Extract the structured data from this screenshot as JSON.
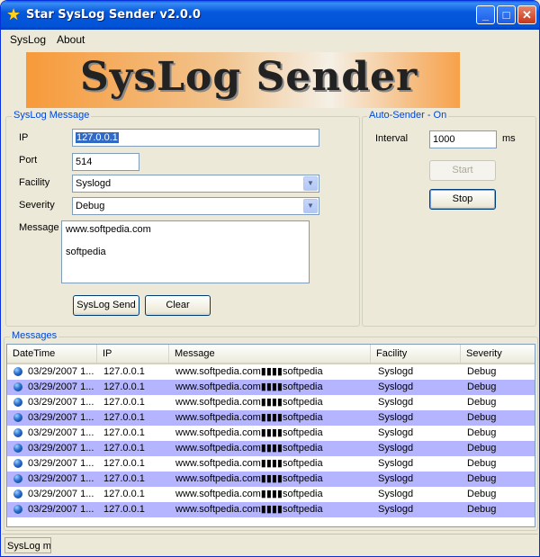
{
  "window": {
    "title": "Star SysLog Sender v2.0.0"
  },
  "menu": [
    "SysLog",
    "About"
  ],
  "banner": {
    "text": "SysLog Sender"
  },
  "syslog_message": {
    "group_label": "SysLog Message",
    "ip_label": "IP",
    "ip_value": "127.0.0.1",
    "port_label": "Port",
    "port_value": "514",
    "facility_label": "Facility",
    "facility_value": "Syslogd",
    "severity_label": "Severity",
    "severity_value": "Debug",
    "message_label": "Message",
    "message_lines": [
      "www.softpedia.com",
      "",
      "softpedia"
    ],
    "send_button": "SysLog Send",
    "clear_button": "Clear"
  },
  "auto_sender": {
    "group_label": "Auto-Sender - On",
    "interval_label": "Interval",
    "interval_value": "1000",
    "ms_label": "ms",
    "start_button": "Start",
    "stop_button": "Stop"
  },
  "messages": {
    "group_label": "Messages",
    "columns": [
      "DateTime",
      "IP",
      "Message",
      "Facility",
      "Severity"
    ],
    "rows": [
      [
        "03/29/2007 1...",
        "127.0.0.1",
        "www.softpedia.com▮▮▮▮softpedia",
        "Syslogd",
        "Debug"
      ],
      [
        "03/29/2007 1...",
        "127.0.0.1",
        "www.softpedia.com▮▮▮▮softpedia",
        "Syslogd",
        "Debug"
      ],
      [
        "03/29/2007 1...",
        "127.0.0.1",
        "www.softpedia.com▮▮▮▮softpedia",
        "Syslogd",
        "Debug"
      ],
      [
        "03/29/2007 1...",
        "127.0.0.1",
        "www.softpedia.com▮▮▮▮softpedia",
        "Syslogd",
        "Debug"
      ],
      [
        "03/29/2007 1...",
        "127.0.0.1",
        "www.softpedia.com▮▮▮▮softpedia",
        "Syslogd",
        "Debug"
      ],
      [
        "03/29/2007 1...",
        "127.0.0.1",
        "www.softpedia.com▮▮▮▮softpedia",
        "Syslogd",
        "Debug"
      ],
      [
        "03/29/2007 1...",
        "127.0.0.1",
        "www.softpedia.com▮▮▮▮softpedia",
        "Syslogd",
        "Debug"
      ],
      [
        "03/29/2007 1...",
        "127.0.0.1",
        "www.softpedia.com▮▮▮▮softpedia",
        "Syslogd",
        "Debug"
      ],
      [
        "03/29/2007 1...",
        "127.0.0.1",
        "www.softpedia.com▮▮▮▮softpedia",
        "Syslogd",
        "Debug"
      ],
      [
        "03/29/2007 1...",
        "127.0.0.1",
        "www.softpedia.com▮▮▮▮softpedia",
        "Syslogd",
        "Debug"
      ]
    ]
  },
  "statusbar": {
    "text": "SysLog me"
  },
  "colors": {
    "title_bar": "#0458dc",
    "row_highlight": "#b4b4ff",
    "group_label": "#0046d5",
    "banner_orange": "#f79a3a"
  }
}
